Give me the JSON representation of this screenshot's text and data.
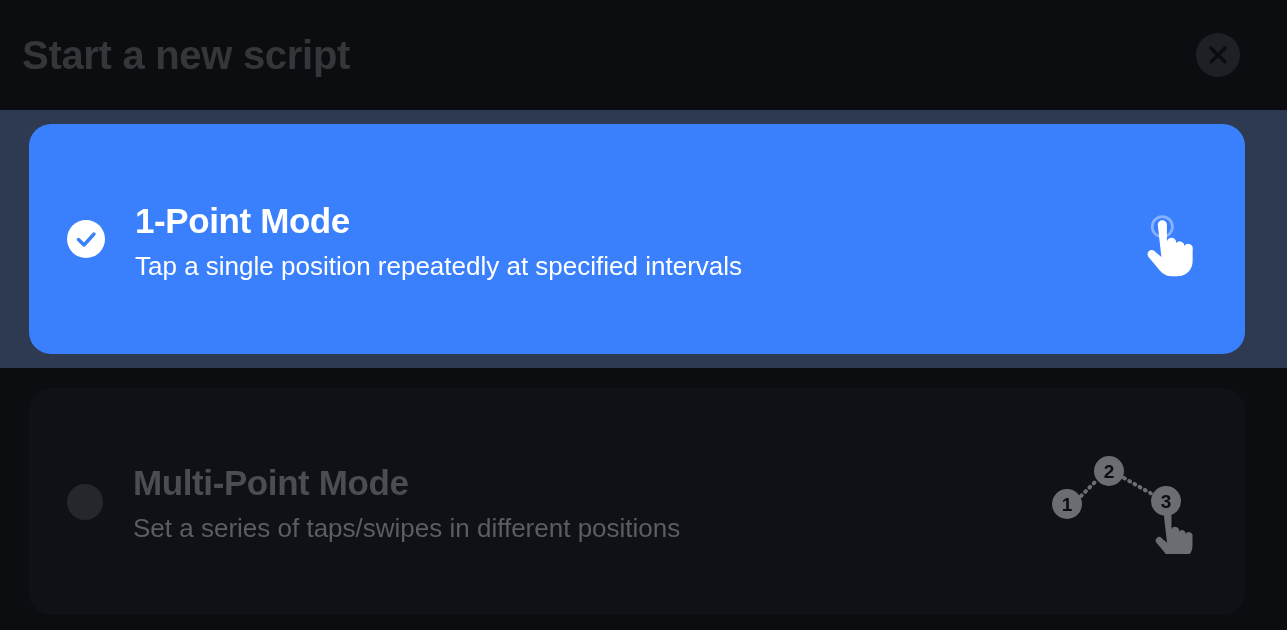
{
  "header": {
    "title": "Start a new script"
  },
  "modes": [
    {
      "kind": "single",
      "title": "1-Point Mode",
      "description": "Tap a single position repeatedly at specified intervals",
      "selected": true
    },
    {
      "kind": "multi",
      "title": "Multi-Point Mode",
      "description": "Set a series of taps/swipes in different positions",
      "selected": false,
      "steps": [
        "1",
        "2",
        "3"
      ]
    }
  ]
}
